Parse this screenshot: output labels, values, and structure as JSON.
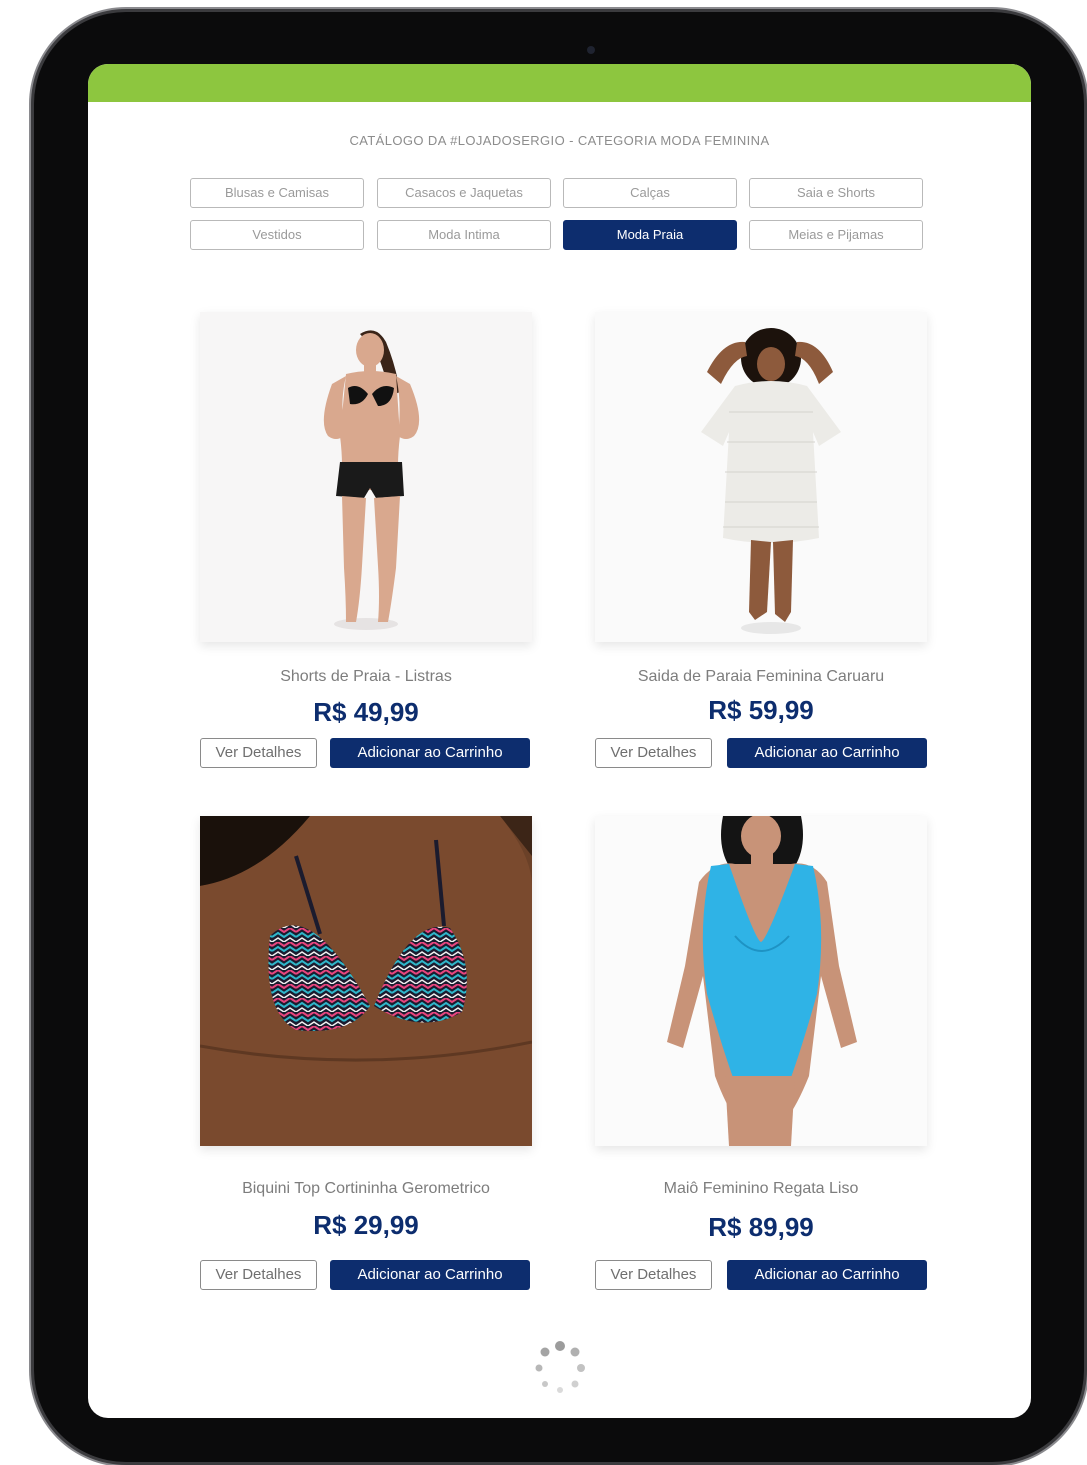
{
  "catalog": {
    "title": "CATÁLOGO DA #LOJADOSERGIO - CATEGORIA MODA FEMININA"
  },
  "categories": [
    {
      "label": "Blusas e Camisas",
      "active": false
    },
    {
      "label": "Casacos e Jaquetas",
      "active": false
    },
    {
      "label": "Calças",
      "active": false
    },
    {
      "label": "Saia e Shorts",
      "active": false
    },
    {
      "label": "Vestidos",
      "active": false
    },
    {
      "label": "Moda Intima",
      "active": false
    },
    {
      "label": "Moda Praia",
      "active": true
    },
    {
      "label": "Meias e Pijamas",
      "active": false
    }
  ],
  "products": [
    {
      "name": "Shorts de Praia - Listras",
      "price": "R$ 49,99"
    },
    {
      "name": "Saida de Paraia Feminina Caruaru",
      "price": "R$ 59,99"
    },
    {
      "name": "Biquini Top Cortininha Gerometrico",
      "price": "R$ 29,99"
    },
    {
      "name": "Maiô Feminino Regata Liso",
      "price": "R$ 89,99"
    }
  ],
  "actions": {
    "details_label": "Ver Detalhes",
    "cart_label": "Adicionar ao Carrinho"
  },
  "colors": {
    "brand_green": "#8dc63f",
    "brand_navy": "#0d2d6e"
  },
  "icons": {
    "loading": "loading-spinner-icon"
  }
}
